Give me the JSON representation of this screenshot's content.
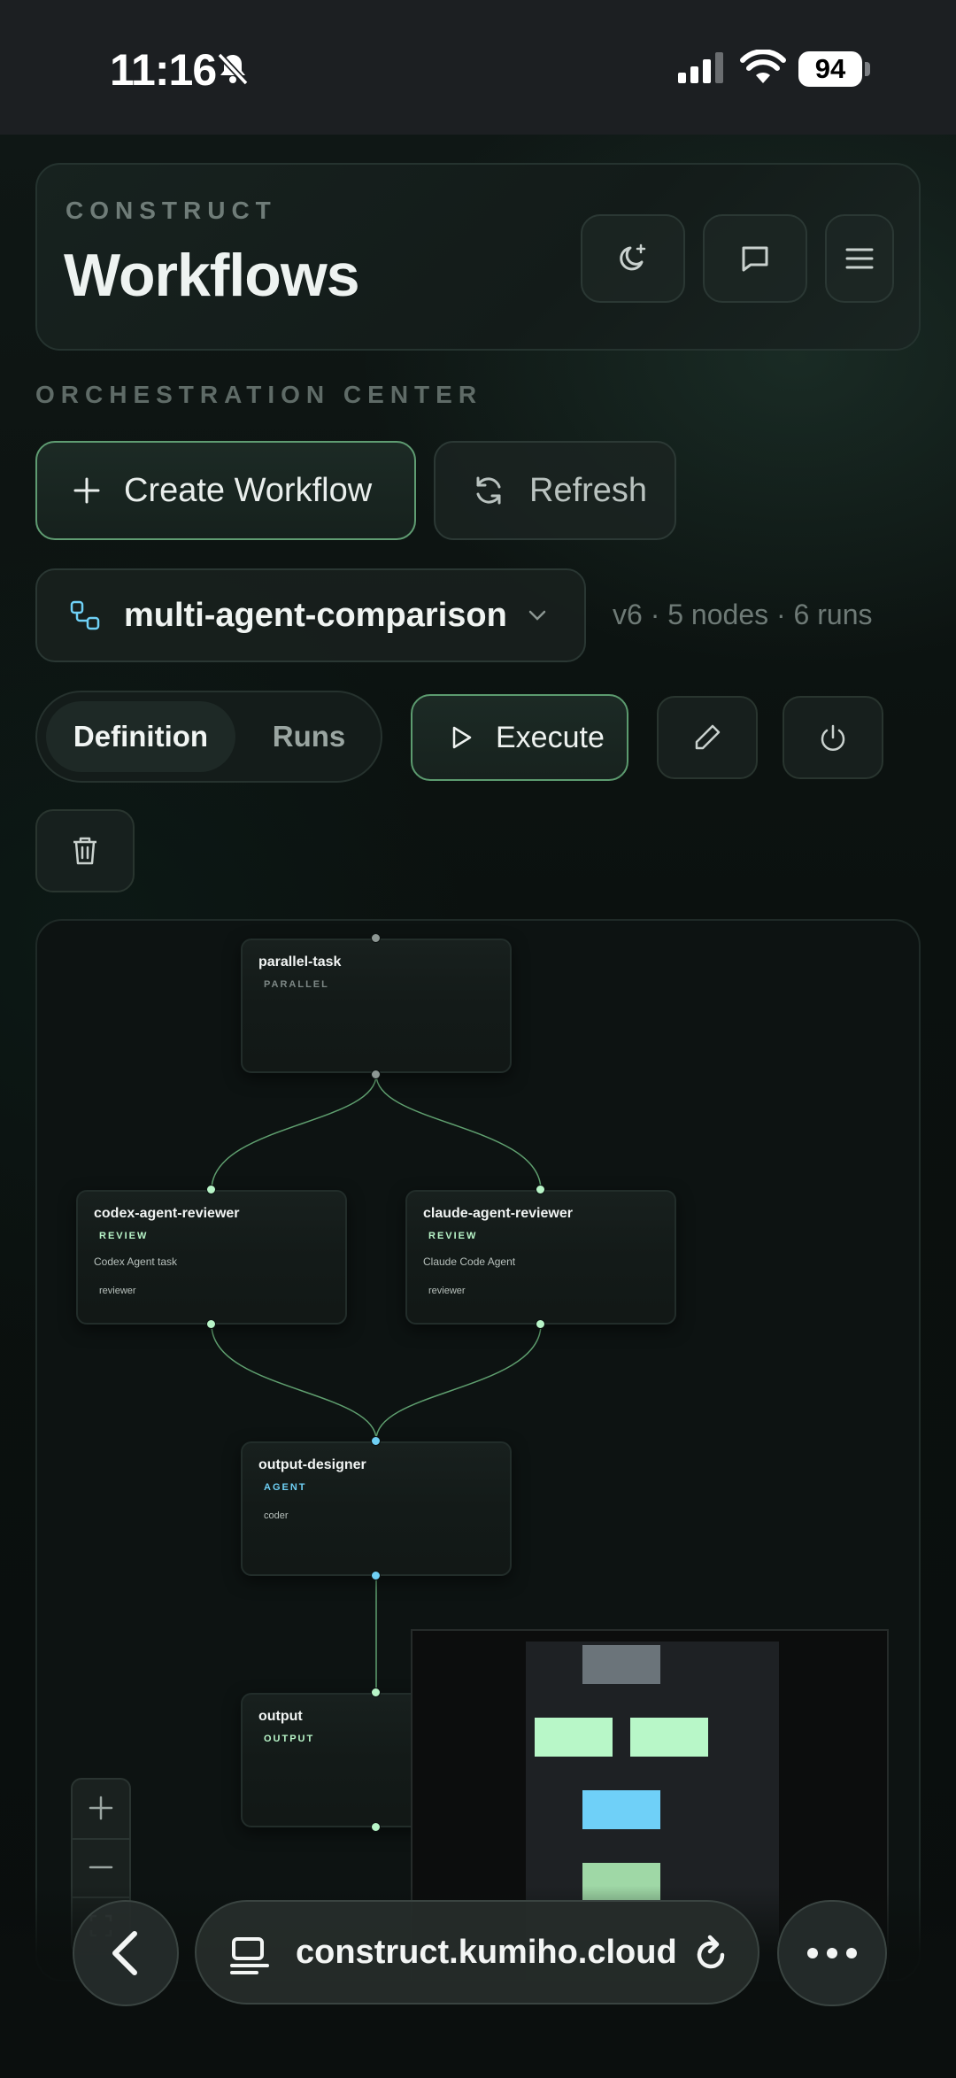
{
  "status_bar": {
    "time": "11:16",
    "battery": "94"
  },
  "header": {
    "eyebrow": "CONSTRUCT",
    "title": "Workflows"
  },
  "section_label": "ORCHESTRATION CENTER",
  "actions": {
    "create_label": "Create Workflow",
    "refresh_label": "Refresh"
  },
  "workflow": {
    "name": "multi-agent-comparison",
    "meta": "v6 · 5 nodes · 6 runs"
  },
  "tabs": [
    {
      "label": "Definition",
      "active": true
    },
    {
      "label": "Runs",
      "active": false
    }
  ],
  "execute_label": "Execute",
  "nodes": [
    {
      "title": "parallel-task",
      "type": "PARALLEL",
      "type_color": "#7d8886",
      "desc": "",
      "tag": ""
    },
    {
      "title": "codex-agent-reviewer",
      "type": "REVIEW",
      "type_color": "#b8f5c8",
      "desc": "Codex Agent task",
      "tag": "reviewer"
    },
    {
      "title": "claude-agent-reviewer",
      "type": "REVIEW",
      "type_color": "#b8f5c8",
      "desc": "Claude Code Agent",
      "tag": "reviewer"
    },
    {
      "title": "output-designer",
      "type": "AGENT",
      "type_color": "#6fd0f5",
      "desc": "",
      "tag": "coder"
    },
    {
      "title": "output",
      "type": "OUTPUT",
      "type_color": "#b8f5c8",
      "desc": "",
      "tag": ""
    }
  ],
  "minimap_colors": {
    "parallel": "#6b747a",
    "review": "#b8f7c8",
    "agent": "#6fd0f8",
    "output": "#9fd8a6"
  },
  "browser": {
    "url": "construct.kumiho.cloud"
  }
}
